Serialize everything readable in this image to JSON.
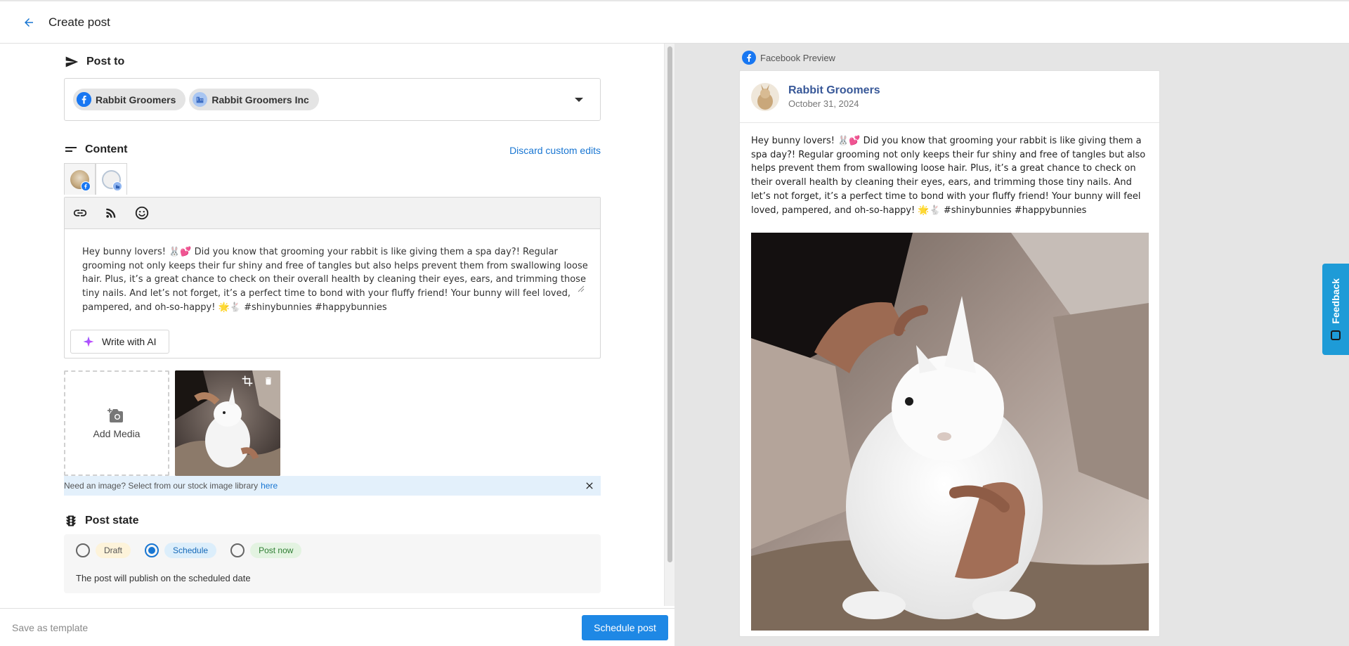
{
  "header": {
    "title": "Create post"
  },
  "post_to": {
    "title": "Post to",
    "chips": [
      {
        "label": "Rabbit Groomers",
        "icon": "facebook-icon",
        "color": "#1877f2"
      },
      {
        "label": "Rabbit Groomers Inc",
        "icon": "business-icon",
        "color": "#8fb5f0"
      }
    ]
  },
  "content": {
    "title": "Content",
    "discard_label": "Discard custom edits",
    "post_text": "Hey bunny lovers! 🐰💕 Did you know that grooming your rabbit is like giving them a spa day?! Regular grooming not only keeps their fur shiny and free of tangles but also helps prevent them from swallowing loose hair. Plus, it’s a great chance to check on their overall health by cleaning their eyes, ears, and trimming those tiny nails. And let’s not forget, it’s a perfect time to bond with your fluffy friend! Your bunny will feel loved, pampered, and oh-so-happy! 🌟🐇 #shinybunnies #happybunnies",
    "toolbar": [
      "link-icon",
      "rss-icon",
      "emoji-icon"
    ],
    "ai_button_label": "Write with AI"
  },
  "media": {
    "add_label": "Add Media",
    "stock_text": "Need an image? Select from our stock image library",
    "stock_link": "here"
  },
  "post_state": {
    "title": "Post state",
    "options": [
      {
        "label": "Draft",
        "checked": false
      },
      {
        "label": "Schedule",
        "checked": true
      },
      {
        "label": "Post now",
        "checked": false
      }
    ],
    "description": "The post will publish on the scheduled date"
  },
  "footer": {
    "save_template_label": "Save as template",
    "schedule_label": "Schedule post"
  },
  "preview": {
    "label": "Facebook Preview",
    "page_name": "Rabbit Groomers",
    "date": "October 31, 2024"
  },
  "feedback_label": "Feedback",
  "colors": {
    "accent": "#1e88e5",
    "facebook": "#1877f2",
    "link": "#1976d2"
  }
}
